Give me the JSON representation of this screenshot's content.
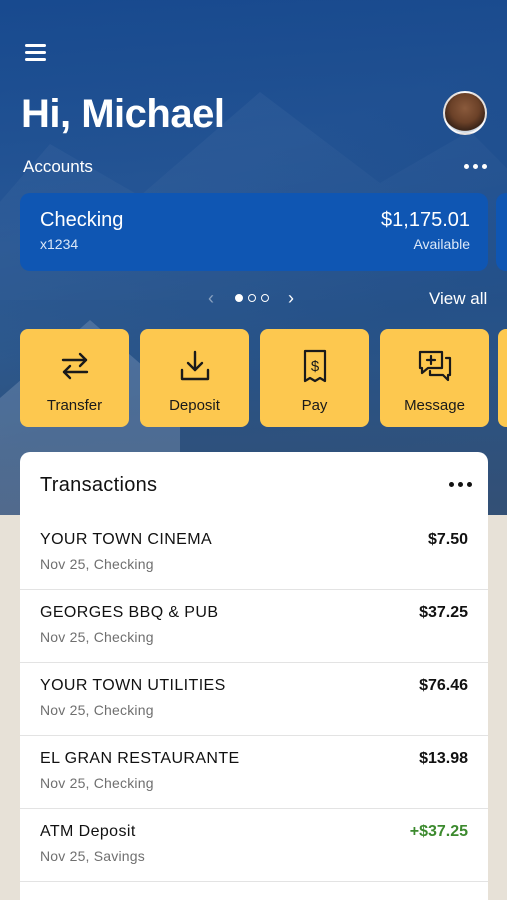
{
  "header": {
    "greeting": "Hi, Michael",
    "accounts_label": "Accounts",
    "view_all": "View all"
  },
  "account": {
    "name": "Checking",
    "number": "x1234",
    "balance": "$1,175.01",
    "status": "Available"
  },
  "pager": {
    "pages": 3,
    "current": 1
  },
  "actions": [
    {
      "label": "Transfer",
      "icon": "transfer-icon"
    },
    {
      "label": "Deposit",
      "icon": "deposit-icon"
    },
    {
      "label": "Pay",
      "icon": "pay-icon"
    },
    {
      "label": "Message",
      "icon": "message-icon"
    }
  ],
  "transactions": {
    "title": "Transactions",
    "items": [
      {
        "merchant": "YOUR TOWN CINEMA",
        "meta": "Nov 25, Checking",
        "amount": "$7.50",
        "credit": false
      },
      {
        "merchant": "GEORGES BBQ & PUB",
        "meta": "Nov 25, Checking",
        "amount": "$37.25",
        "credit": false
      },
      {
        "merchant": "YOUR TOWN UTILITIES",
        "meta": "Nov 25, Checking",
        "amount": "$76.46",
        "credit": false
      },
      {
        "merchant": "EL GRAN RESTAURANTE",
        "meta": "Nov 25, Checking",
        "amount": "$13.98",
        "credit": false
      },
      {
        "merchant": "ATM Deposit",
        "meta": "Nov 25, Savings",
        "amount": "+$37.25",
        "credit": true
      }
    ]
  },
  "colors": {
    "brand_blue": "#0f56b3",
    "action_yellow": "#fdc84f",
    "credit_green": "#3c8a2e"
  }
}
